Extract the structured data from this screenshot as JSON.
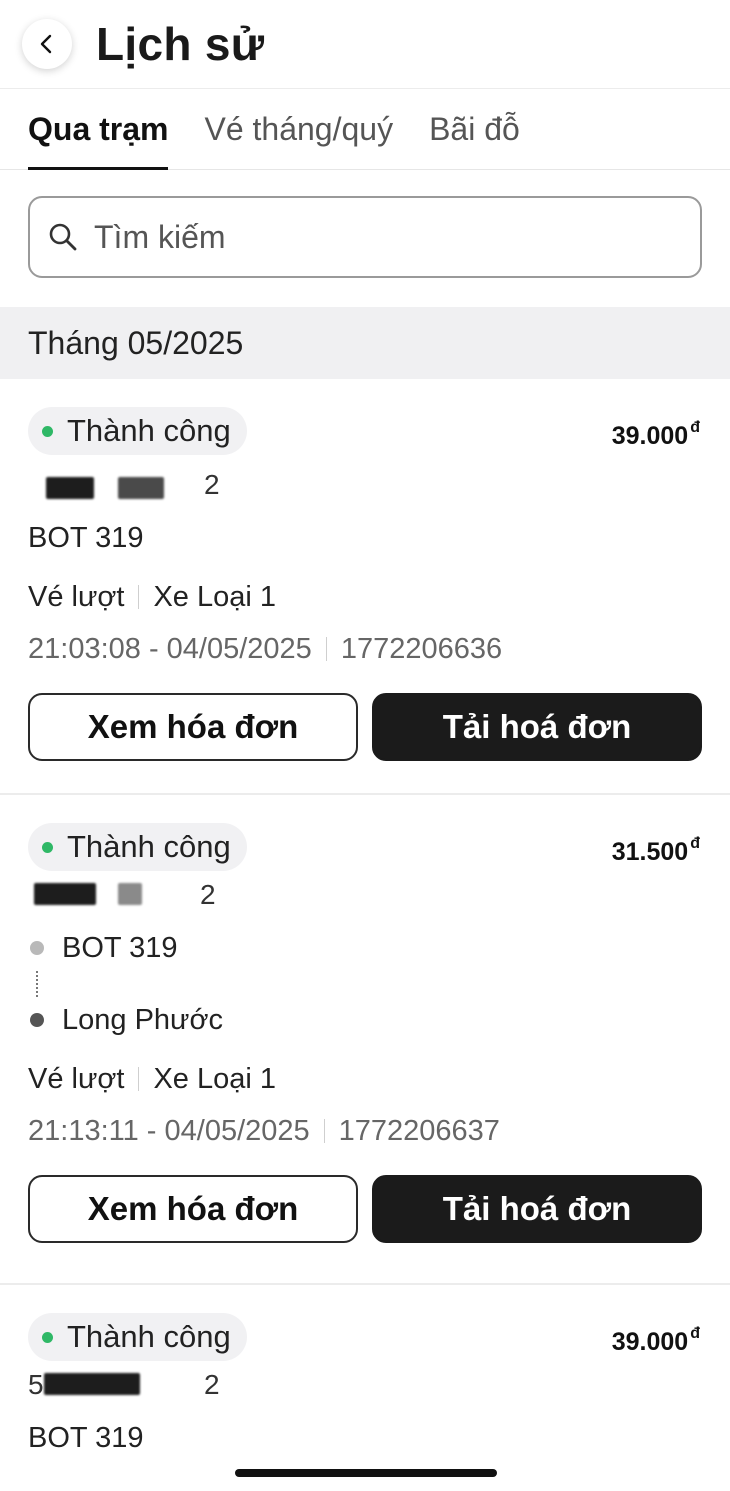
{
  "header": {
    "title": "Lịch sử",
    "back_icon": "chevron-left-icon"
  },
  "tabs": [
    {
      "label": "Qua trạm",
      "active": true
    },
    {
      "label": "Vé tháng/quý",
      "active": false
    },
    {
      "label": "Bãi đỗ",
      "active": false
    }
  ],
  "search": {
    "placeholder": "Tìm kiếm",
    "value": "",
    "icon": "search-icon"
  },
  "month_header": "Tháng 05/2025",
  "colors": {
    "success_dot": "#2fb866",
    "dark_button": "#1b1b1b"
  },
  "records": [
    {
      "status": "Thành công",
      "amount": "39.000",
      "currency": "đ",
      "plate_suffix": "2",
      "station": "BOT 319",
      "ticket_type": "Vé lượt",
      "vehicle_class": "Xe Loại 1",
      "datetime": "21:03:08 - 04/05/2025",
      "transaction_id": "1772206636",
      "view_label": "Xem hóa đơn",
      "download_label": "Tải hoá đơn"
    },
    {
      "status": "Thành công",
      "amount": "31.500",
      "currency": "đ",
      "plate_suffix": "2",
      "route_from": "BOT 319",
      "route_to": "Long Phước",
      "ticket_type": "Vé lượt",
      "vehicle_class": "Xe Loại 1",
      "datetime": "21:13:11 - 04/05/2025",
      "transaction_id": "1772206637",
      "view_label": "Xem hóa đơn",
      "download_label": "Tải hoá đơn"
    },
    {
      "status": "Thành công",
      "amount": "39.000",
      "currency": "đ",
      "plate_prefix": "5",
      "plate_suffix": "2",
      "station": "BOT 319"
    }
  ]
}
